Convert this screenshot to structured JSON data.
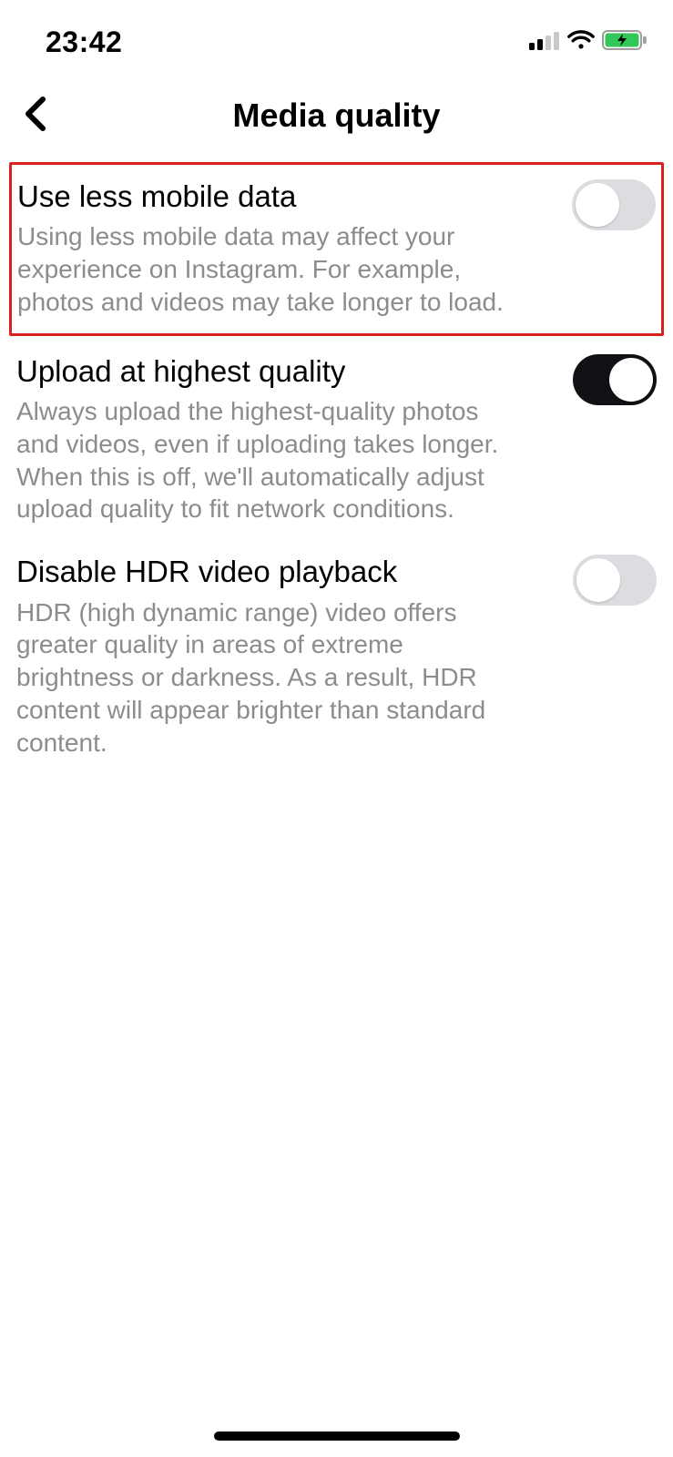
{
  "status_bar": {
    "time": "23:42",
    "cellular_bars_filled": 2,
    "cellular_bars_total": 4,
    "wifi": true,
    "battery_charging": true
  },
  "header": {
    "back_icon": "chevron-left",
    "title": "Media quality"
  },
  "settings": [
    {
      "key": "use_less_mobile_data",
      "title": "Use less mobile data",
      "description": "Using less mobile data may affect your experience on Instagram. For example, photos and videos may take longer to load.",
      "enabled": false,
      "highlighted": true
    },
    {
      "key": "upload_at_highest_quality",
      "title": "Upload at highest quality",
      "description": "Always upload the highest-quality photos and videos, even if uploading takes longer. When this is off, we'll automatically adjust upload quality to fit network conditions.",
      "enabled": true,
      "highlighted": false
    },
    {
      "key": "disable_hdr_video_playback",
      "title": "Disable HDR video playback",
      "description": "HDR (high dynamic range) video offers greater quality in areas of extreme brightness or darkness. As a result, HDR content will appear brighter than standard content.",
      "enabled": false,
      "highlighted": false
    }
  ],
  "colors": {
    "highlight_border": "#d9221d",
    "desc_text": "#8c8c8c",
    "toggle_off_bg": "#dcdde0",
    "toggle_on_bg": "#0f1115",
    "battery_green": "#32c759"
  }
}
